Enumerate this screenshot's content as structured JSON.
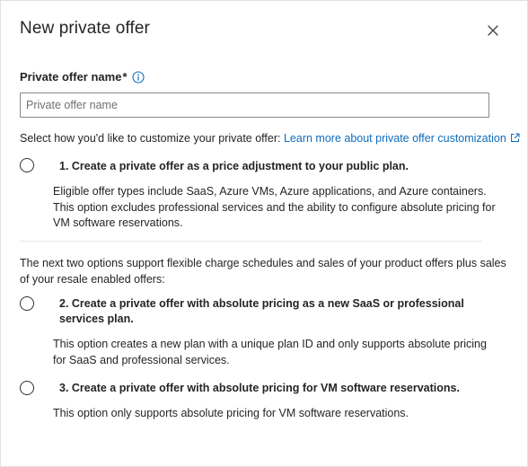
{
  "dialog": {
    "title": "New private offer",
    "close_icon": "close-icon"
  },
  "name_field": {
    "label": "Private offer name",
    "required_marker": "*",
    "info_icon": "info-icon",
    "placeholder": "Private offer name",
    "value": ""
  },
  "customize": {
    "intro": "Select how you'd like to customize your private offer: ",
    "link_text": "Learn more about private offer customization",
    "link_icon": "external-link-icon"
  },
  "options": [
    {
      "title": "1. Create a private offer as a price adjustment to your public plan.",
      "description": "Eligible offer types include SaaS, Azure VMs, Azure applications, and Azure containers. This option excludes professional services and the ability to configure absolute pricing for VM software reservations.",
      "selected": false
    },
    {
      "title": "2. Create a private offer with absolute pricing as a new SaaS or professional services plan.",
      "description": "This option creates a new plan with a unique plan ID and only supports absolute pricing for SaaS and professional services.",
      "selected": false
    },
    {
      "title": "3. Create a private offer with absolute pricing for VM software reservations.",
      "description": "This option only supports absolute pricing for VM software reservations.",
      "selected": false
    }
  ],
  "flexible_note": "The next two options support flexible charge schedules and sales of your product offers plus sales of your resale enabled offers:",
  "colors": {
    "link": "#0f6cbd",
    "text": "#242424",
    "border": "#8a8886"
  }
}
